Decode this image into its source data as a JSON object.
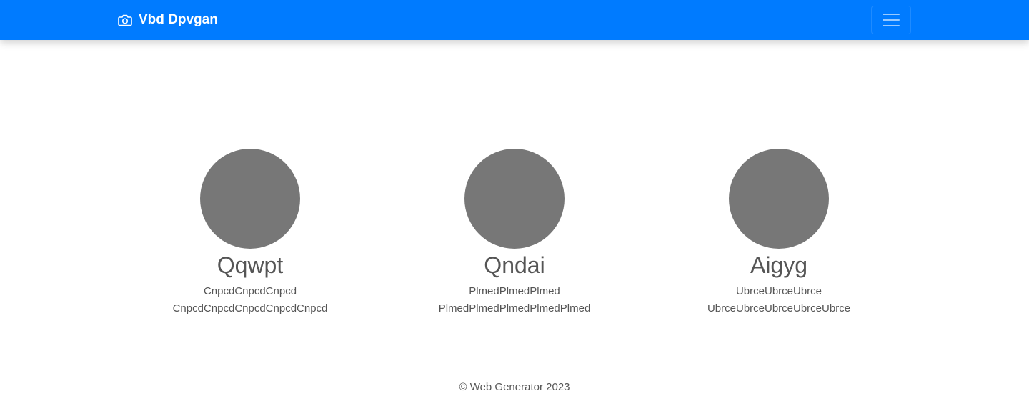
{
  "navbar": {
    "brand_icon": "camera-icon",
    "brand_text": "Vbd Dpvgan",
    "toggler_icon": "hamburger-menu-icon",
    "background_color": "#007bff"
  },
  "cards": [
    {
      "name": "Qqwpt",
      "line1": "CnpcdCnpcdCnpcd",
      "line2": "CnpcdCnpcdCnpcdCnpcdCnpcd"
    },
    {
      "name": "Qndai",
      "line1": "PlmedPlmedPlmed",
      "line2": "PlmedPlmedPlmedPlmedPlmed"
    },
    {
      "name": "Aigyg",
      "line1": "UbrceUbrceUbrce",
      "line2": "UbrceUbrceUbrceUbrceUbrce"
    }
  ],
  "footer": {
    "copyright": "© Web Generator 2023"
  }
}
